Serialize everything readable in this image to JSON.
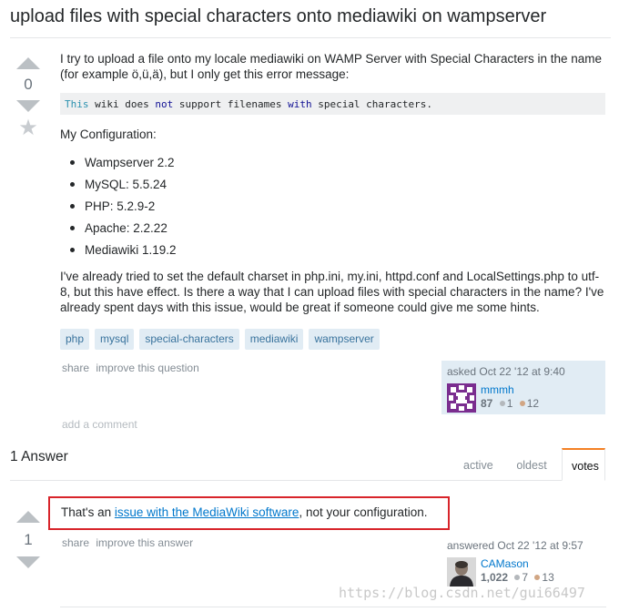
{
  "question": {
    "title": "upload files with special characters onto mediawiki on wampserver",
    "votes": "0",
    "intro": "I try to upload a file onto my locale mediawiki on WAMP Server with Special Characters in the name (for example ö,ü,ä), but I only get this error message:",
    "code": {
      "w1": "This",
      "w2": " wiki does ",
      "w3": "not",
      "w4": " support filenames ",
      "w5": "with",
      "w6": " special characters."
    },
    "config_heading": "My Configuration:",
    "config_items": [
      "Wampserver 2.2",
      "MySQL: 5.5.24",
      "PHP: 5.2.9-2",
      "Apache: 2.2.22",
      "Mediawiki 1.19.2"
    ],
    "body_end": "I've already tried to set the default charset in php.ini, my.ini, httpd.conf and LocalSettings.php to utf-8, but this have effect. Is there a way that I can upload files with special characters in the name? I've already spent days with this issue, would be great if someone could give me some hints.",
    "tags": [
      "php",
      "mysql",
      "special-characters",
      "mediawiki",
      "wampserver"
    ],
    "menu": {
      "share": "share",
      "improve": "improve this question"
    },
    "asker": {
      "action_time": "asked Oct 22 '12 at 9:40",
      "name": "mmmh",
      "rep": "87",
      "silver": "1",
      "bronze": "12"
    },
    "add_comment": "add a comment"
  },
  "answers_section": {
    "count_label": "1 Answer",
    "tabs": [
      "active",
      "oldest",
      "votes"
    ],
    "selected_tab": "votes"
  },
  "answer": {
    "votes": "1",
    "text_before": "That's an ",
    "link_text": "issue with the MediaWiki software",
    "text_after": ", not your configuration.",
    "menu": {
      "share": "share",
      "improve": "improve this answer"
    },
    "answerer": {
      "action_time": "answered Oct 22 '12 at 9:57",
      "name": "CAMason",
      "rep": "1,022",
      "silver": "7",
      "bronze": "13"
    }
  },
  "watermark": "https://blog.csdn.net/gui66497",
  "colors": {
    "link": "#0077cc",
    "tag_bg": "#e1ecf4",
    "highlight_border": "#d8242a",
    "active_tab_accent": "#f48024"
  }
}
